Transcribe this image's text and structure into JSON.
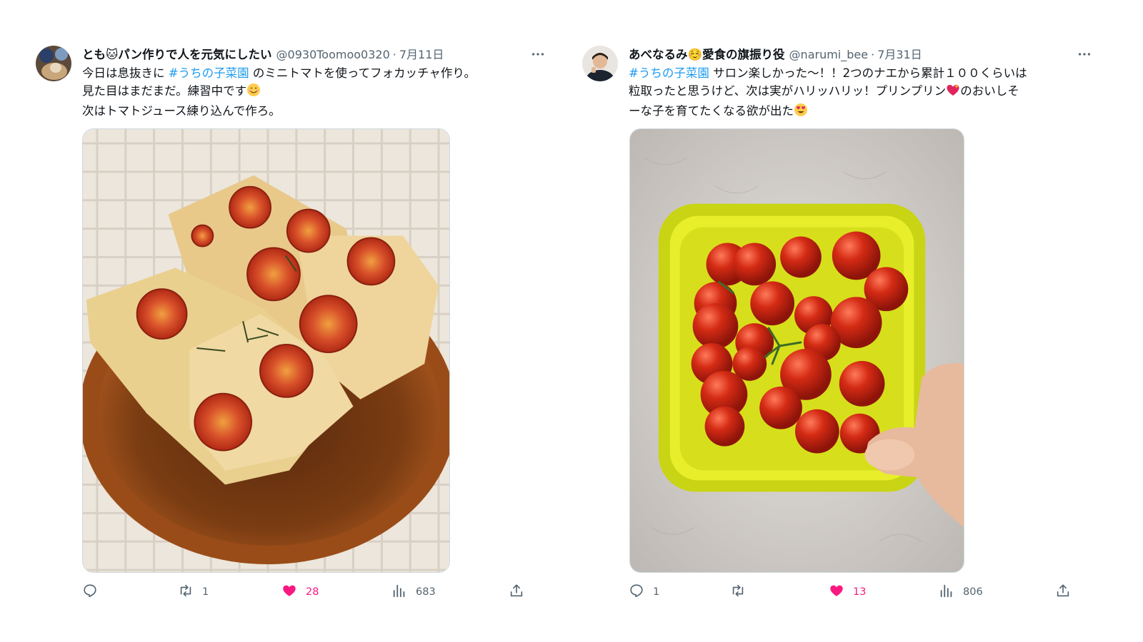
{
  "tweets": [
    {
      "name": "とも🐱パン作りで人を元気にしたい",
      "handle": "@0930Toomoo0320",
      "sep": "·",
      "date": "7月11日",
      "text": {
        "l1_pre": "今日は息抜きに ",
        "hashtag": "#うちの子菜園",
        "l1_post": " のミニトマトを使ってフォカッチャ作り。",
        "l2": "見た目はまだまだ。練習中です",
        "l3": "次はトマトジュース練り込んで作ろ。"
      },
      "stats": {
        "replies": "",
        "retweets": "1",
        "likes": "28",
        "views": "683"
      }
    },
    {
      "name": "あべなるみ☺️愛食の旗振り役",
      "handle": "@narumi_bee",
      "sep": "·",
      "date": "7月31日",
      "text": {
        "hashtag": "#うちの子菜園",
        "l1_post": " サロン楽しかった〜！！2つのナエから累計１００くらいは",
        "l2": "粒取ったと思うけど、次は実がハリッハリッ！プリンプリン",
        "l2_post": "のおいしそ",
        "l3": "ーな子を育てたくなる欲が出た"
      },
      "stats": {
        "replies": "1",
        "retweets": "",
        "likes": "13",
        "views": "806"
      }
    }
  ],
  "colors": {
    "accent": "#1d9bf0",
    "like": "#f91880",
    "muted": "#536471"
  },
  "icons": [
    "more-icon",
    "reply-icon",
    "retweet-icon",
    "heart-icon",
    "views-icon",
    "share-icon"
  ]
}
